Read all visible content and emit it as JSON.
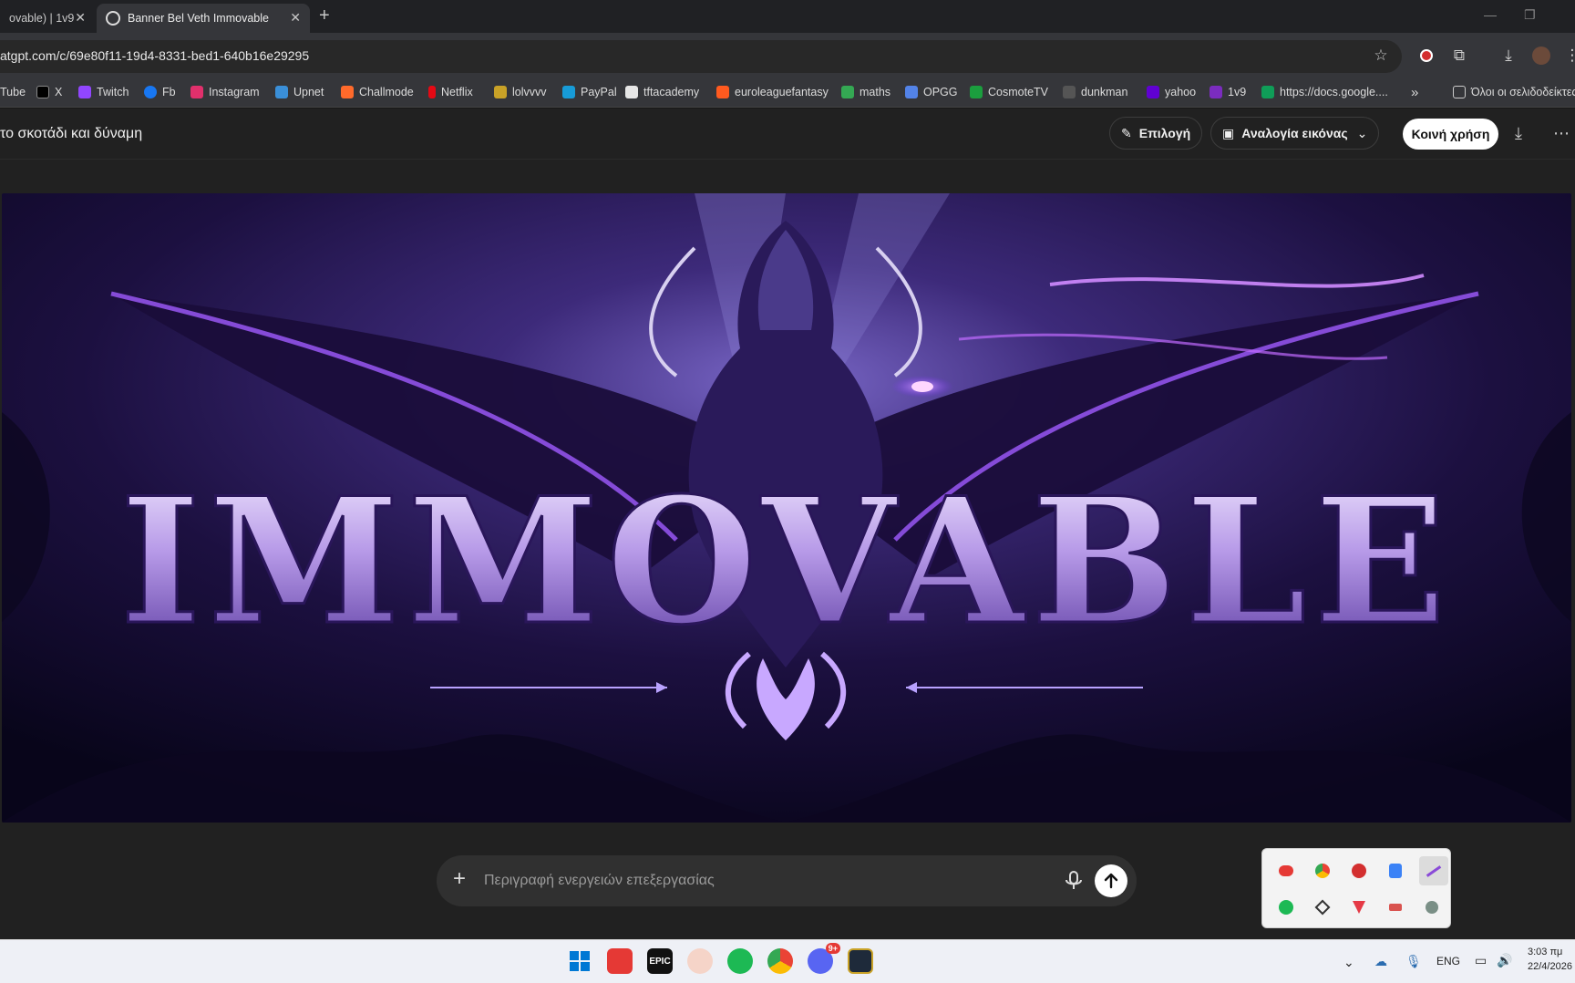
{
  "browser": {
    "tabs": [
      {
        "title": "ovable) | 1v9"
      },
      {
        "title": "Banner Bel Veth Immovable"
      }
    ],
    "url": "atgpt.com/c/69e80f11-19d4-8331-bed1-640b16e29295",
    "bookmarks": [
      {
        "label": "Tube",
        "color": "#ff0000"
      },
      {
        "label": "X",
        "color": "#000000"
      },
      {
        "label": "Twitch",
        "color": "#9146ff"
      },
      {
        "label": "Fb",
        "color": "#1877f2"
      },
      {
        "label": "Instagram",
        "color": "#e1306c"
      },
      {
        "label": "Upnet",
        "color": "#3a8fd8"
      },
      {
        "label": "Challmode",
        "color": "#ff6a2b"
      },
      {
        "label": "Netflix",
        "color": "#e50914"
      },
      {
        "label": "lolvvvv",
        "color": "#c9a227"
      },
      {
        "label": "PayPal",
        "color": "#179bd7"
      },
      {
        "label": "tftacademy",
        "color": "#e6e6e6"
      },
      {
        "label": "euroleaguefantasy",
        "color": "#ff5a1f"
      },
      {
        "label": "maths",
        "color": "#34a853"
      },
      {
        "label": "OPGG",
        "color": "#5383e8"
      },
      {
        "label": "CosmoteTV",
        "color": "#1b9e3e"
      },
      {
        "label": "dunkman",
        "color": "#555555"
      },
      {
        "label": "yahoo",
        "color": "#6001d2"
      },
      {
        "label": "1v9",
        "color": "#7b2cbf"
      },
      {
        "label": "https://docs.google....",
        "color": "#0f9d58"
      }
    ],
    "bookmarks_more": "»",
    "all_bookmarks": "Όλοι οι σελιδοδείκτες"
  },
  "app": {
    "chat_title": "το σκοτάδι και δύναμη",
    "select_label": "Επιλογή",
    "aspect_label": "Αναλογία εικόνας",
    "share_label": "Κοινή χρήση"
  },
  "image": {
    "banner_text": "IMMOVABLE"
  },
  "prompt": {
    "placeholder": "Περιγραφή ενεργειών επεξεργασίας"
  },
  "system": {
    "lang": "ENG",
    "time": "3:03 πμ",
    "date": "22/4/2026",
    "discord_badge": "9+"
  }
}
